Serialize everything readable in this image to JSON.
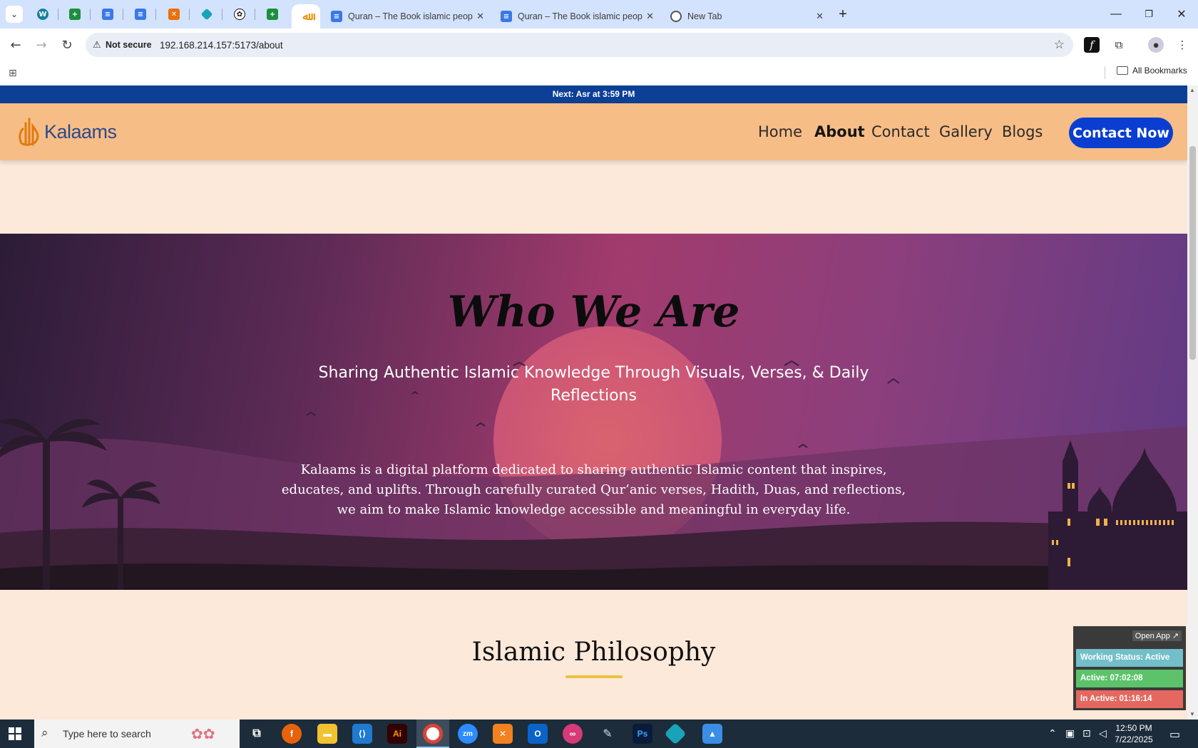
{
  "browser": {
    "tabs": [
      {
        "title": "Quran – The Book islamic peop",
        "favicon": "docs-icon"
      },
      {
        "title": "Quran – The Book islamic peop",
        "favicon": "docs-icon"
      },
      {
        "title": "New Tab",
        "favicon": "chrome-icon"
      }
    ],
    "security_label": "Not secure",
    "url": "192.168.214.157:5173/about",
    "all_bookmarks": "All Bookmarks"
  },
  "page": {
    "prayer_prefix": "Next:",
    "prayer_name": "Asr",
    "prayer_time": "at 3:59 PM",
    "logo_text": "Kalaams",
    "nav": [
      {
        "label": "Home",
        "active": false
      },
      {
        "label": "About",
        "active": true
      },
      {
        "label": "Contact",
        "active": false
      },
      {
        "label": "Gallery",
        "active": false
      },
      {
        "label": "Blogs",
        "active": false
      }
    ],
    "cta_label": "Contact Now",
    "hero": {
      "title": "Who We Are",
      "subtitle": "Sharing Authentic Islamic Knowledge Through Visuals, Verses, & Daily Reflections",
      "body": "Kalaams is a digital platform dedicated to sharing authentic Islamic content that inspires, educates, and uplifts. Through carefully curated Qur’anic verses, Hadith, Duas, and reflections, we aim to make Islamic knowledge accessible and meaningful in everyday life."
    },
    "section_title": "Islamic Philosophy"
  },
  "tracker": {
    "open_label": "Open App ↗",
    "status": "Working Status: Active",
    "active": "Active: 07:02:08",
    "inactive": "In Active: 01:16:14"
  },
  "taskbar": {
    "search_placeholder": "Type here to search",
    "time": "12:50 PM",
    "date": "7/22/2025"
  },
  "colors": {
    "prayer_bar": "#0c3f96",
    "navbar": "#f7bd86",
    "cta": "#0a3ed0",
    "page_bg": "#fde9da",
    "accent_line": "#f0c040"
  }
}
